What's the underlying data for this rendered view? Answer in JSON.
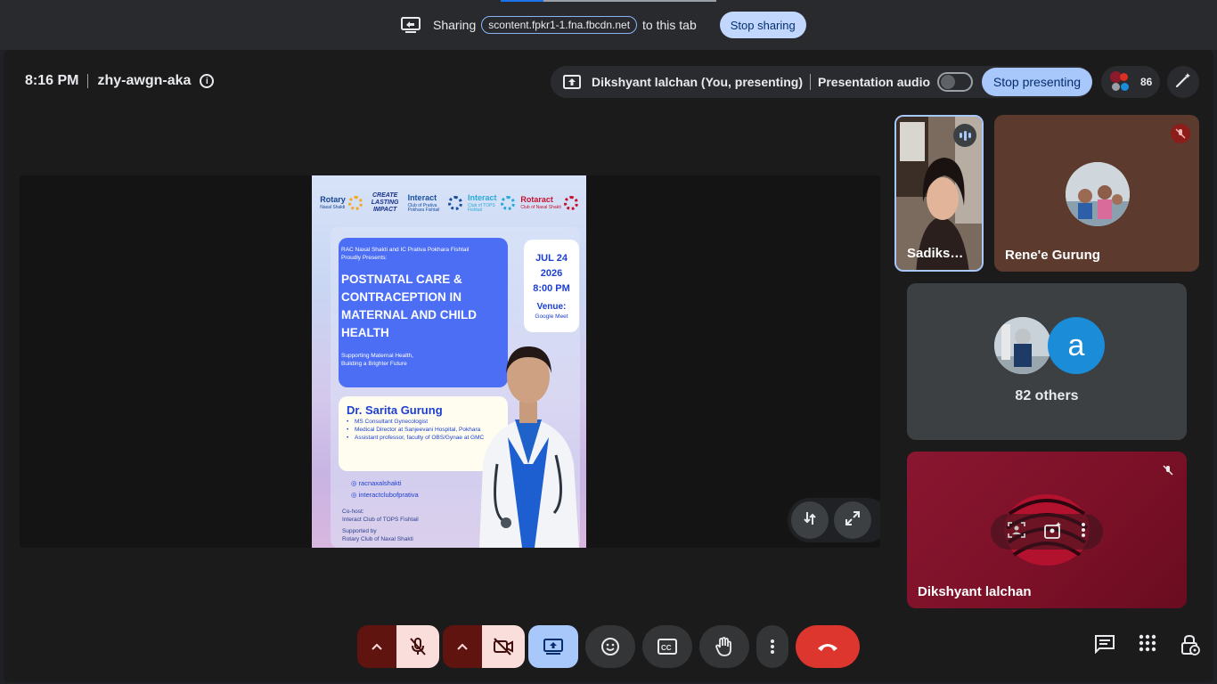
{
  "sharing_bar": {
    "prefix": "Sharing",
    "url": "scontent.fpkr1-1.fna.fbcdn.net",
    "suffix": "to this tab",
    "stop_label": "Stop sharing"
  },
  "meeting": {
    "time": "8:16 PM",
    "code": "zhy-awgn-aka",
    "presenter": "Dikshyant lalchan (You, presenting)",
    "audio_label": "Presentation audio",
    "stop_presenting_label": "Stop presenting",
    "participant_count": "86"
  },
  "poster": {
    "logos": {
      "rotary": "Rotary",
      "rotary_sub": "Naxal Shakti",
      "impact": "CREATE LASTING IMPACT",
      "interact1": "Interact",
      "interact1_sub": "Club of Prativa Pokhara Fishtail",
      "interact2": "Interact",
      "interact2_sub": "Club of TOPS Fishtail",
      "rotaract": "Rotaract",
      "rotaract_sub": "Club of Naxal Shakti"
    },
    "presents_line1": "RAC Naxal Shakti and IC Prativa Pokhara Fishtail",
    "presents_line2": "Proudly Presents:",
    "headline": "POSTNATAL CARE & CONTRACEPTION IN MATERNAL AND CHILD HEALTH",
    "tagline_line1": "Supporting Maternal Health,",
    "tagline_line2": "Building a Brighter Future",
    "date": "JUL 24",
    "year": "2026",
    "time": "8:00 PM",
    "venue_label": "Venue:",
    "venue": "Google Meet",
    "doctor_name": "Dr. Sarita Gurung",
    "credentials": [
      "MS Consultant Gynecologist",
      "Medical Director at Sanjeevani Hospital, Pokhara",
      "Assistant professor, faculty of OBS/Gynae at GMC"
    ],
    "handle1": "racnaxalshakti",
    "handle2": "interactclubofprativa",
    "cohost_label": "Co-host:",
    "cohost": "Interact Club of TOPS Fishtail",
    "supported_label": "Supported by",
    "supported": "Rotary Club of Naxal Shakti"
  },
  "tiles": {
    "sadiksha": "Sadiks…",
    "rene": "Rene'e Gurung",
    "others_count": "82 others",
    "others_letter": "a",
    "self": "Dikshyant lalchan"
  },
  "icons": {
    "share": "screen-share-icon",
    "info": "info-icon",
    "people": "people-icon",
    "pen": "magic-pen-icon",
    "mic_off": "mic-off-icon",
    "cam_off": "camera-off-icon",
    "present": "present-screen-icon",
    "emoji": "emoji-icon",
    "captions": "captions-icon",
    "hand": "raise-hand-icon",
    "more": "more-vert-icon",
    "leave": "call-end-icon",
    "chat": "chat-icon",
    "activities": "apps-grid-icon",
    "host": "host-controls-icon"
  },
  "colors": {
    "accent": "#a8c7fa",
    "leave": "#dc362e",
    "mute_bg": "#f9dedc"
  }
}
